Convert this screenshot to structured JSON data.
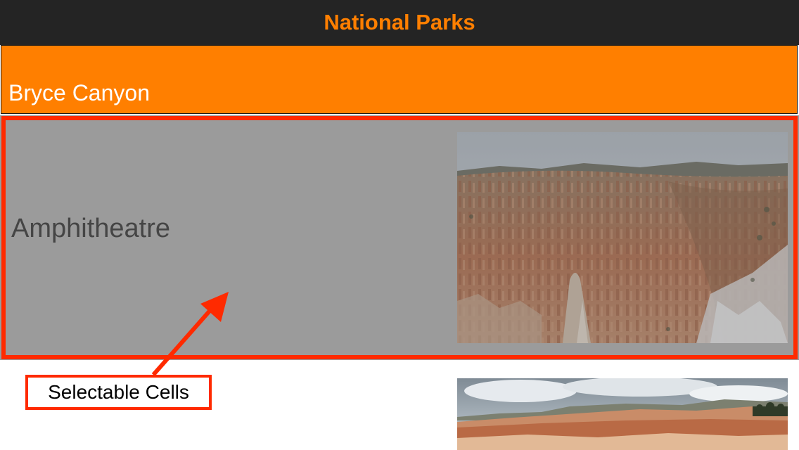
{
  "navbar": {
    "title": "National Parks",
    "title_color": "#ff7f00",
    "background": "#242424"
  },
  "section": {
    "header": "Bryce Canyon",
    "header_color": "#ff7f00"
  },
  "cells": [
    {
      "label": "Amphitheatre",
      "image": "amphitheatre-photo",
      "selected": true
    },
    {
      "label": "",
      "image": "bryce-point-photo",
      "selected": false
    }
  ],
  "annotation": {
    "callout": "Selectable Cells",
    "color": "#ff2a00"
  }
}
